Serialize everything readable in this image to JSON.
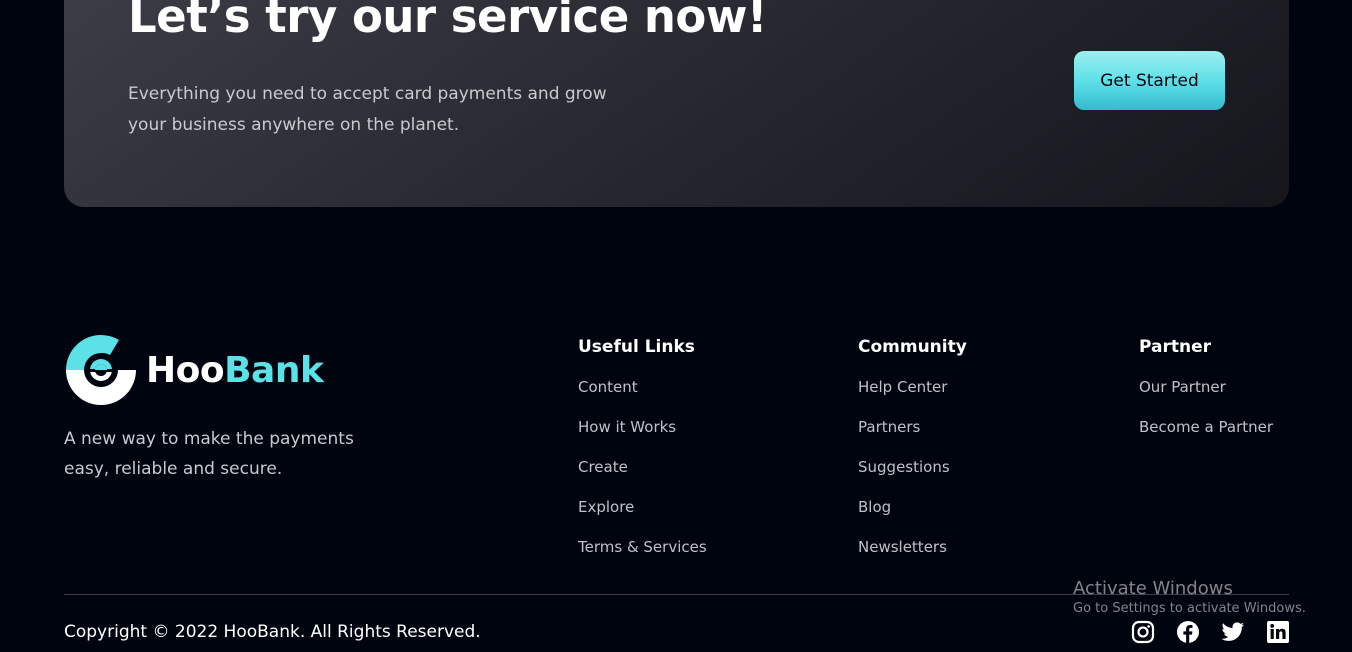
{
  "cta": {
    "title": "Let’s try our service now!",
    "text": "Everything you need to accept card payments and grow your business anywhere on the planet.",
    "button_label": "Get Started"
  },
  "logo": {
    "word_part1": "Hoo",
    "word_part2": "Bank",
    "mark_icon": "hoobank-logo-icon"
  },
  "tagline": "A new way to make the payments easy, reliable and secure.",
  "footer": {
    "columns": [
      {
        "title": "Useful Links",
        "links": [
          "Content",
          "How it Works",
          "Create",
          "Explore",
          "Terms & Services"
        ]
      },
      {
        "title": "Community",
        "links": [
          "Help Center",
          "Partners",
          "Suggestions",
          "Blog",
          "Newsletters"
        ]
      },
      {
        "title": "Partner",
        "links": [
          "Our Partner",
          "Become a Partner"
        ]
      }
    ],
    "copyright": "Copyright © 2022 HooBank. All Rights Reserved.",
    "socials": [
      "instagram-icon",
      "facebook-icon",
      "twitter-icon",
      "linkedin-icon"
    ]
  },
  "watermark": {
    "title": "Activate Windows",
    "subtitle": "Go to Settings to activate Windows."
  },
  "colors": {
    "background": "#00040f",
    "accent": "#5ce1e6",
    "text_muted": "#c9c9cf"
  }
}
